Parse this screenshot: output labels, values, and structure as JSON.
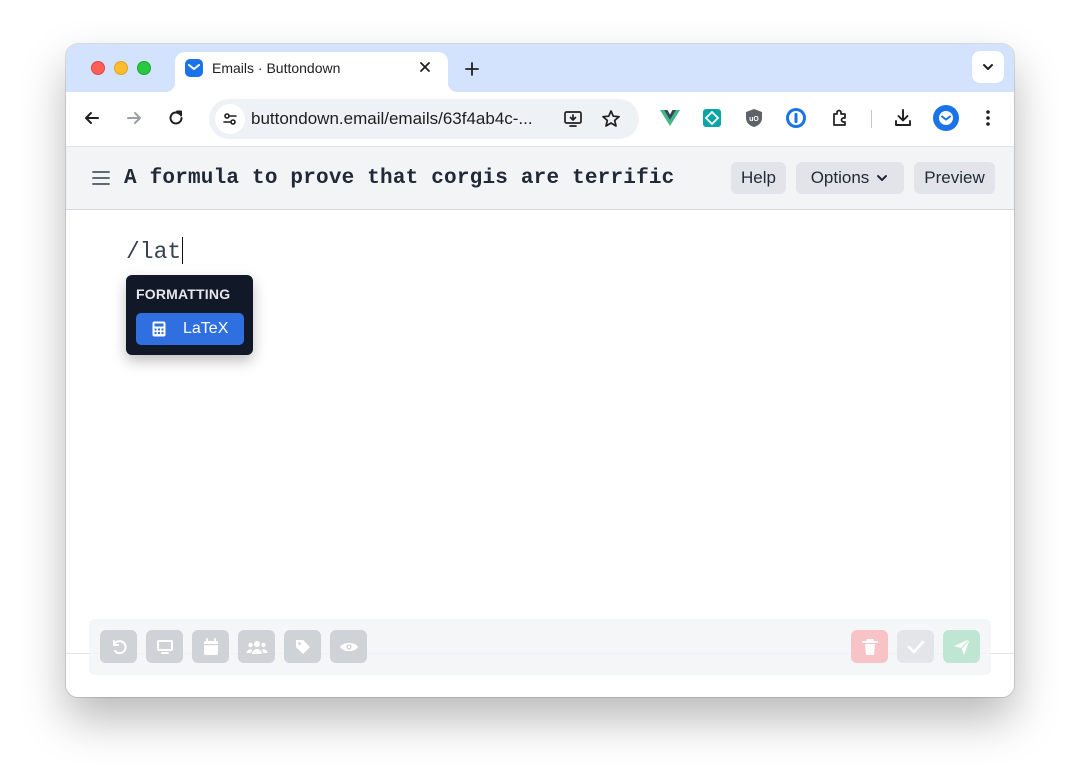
{
  "browser": {
    "tab": {
      "title": "Emails · Buttondown",
      "favicon": "buttondown-favicon-icon"
    },
    "new_tab_symbol": "+",
    "address_bar": {
      "url": "buttondown.email/emails/63f4ab4c-..."
    },
    "extensions": [
      "vue-devtools-icon",
      "teal-extension-icon",
      "ublock-origin-icon",
      "1password-icon",
      "extensions-puzzle-icon"
    ],
    "colors": {
      "tabstrip": "#d3e3fd",
      "accent": "#1a73e8"
    }
  },
  "app": {
    "subject": "A formula to prove that corgis are terrific",
    "header_buttons": {
      "help": "Help",
      "options": "Options",
      "preview": "Preview"
    }
  },
  "editor": {
    "draft_text": "/lat",
    "slash_menu": {
      "section": "FORMATTING",
      "items": [
        {
          "label": "LaTeX",
          "icon": "calculator-icon",
          "selected": true
        }
      ]
    }
  },
  "action_bar": {
    "left_buttons": [
      "undo-icon",
      "monitor-icon",
      "calendar-icon",
      "users-icon",
      "tag-icon",
      "eye-icon"
    ],
    "right_buttons": [
      "trash-icon",
      "check-icon",
      "send-icon"
    ],
    "colors": {
      "delete": "#f7c3c6",
      "send": "#bfe6d2"
    }
  }
}
